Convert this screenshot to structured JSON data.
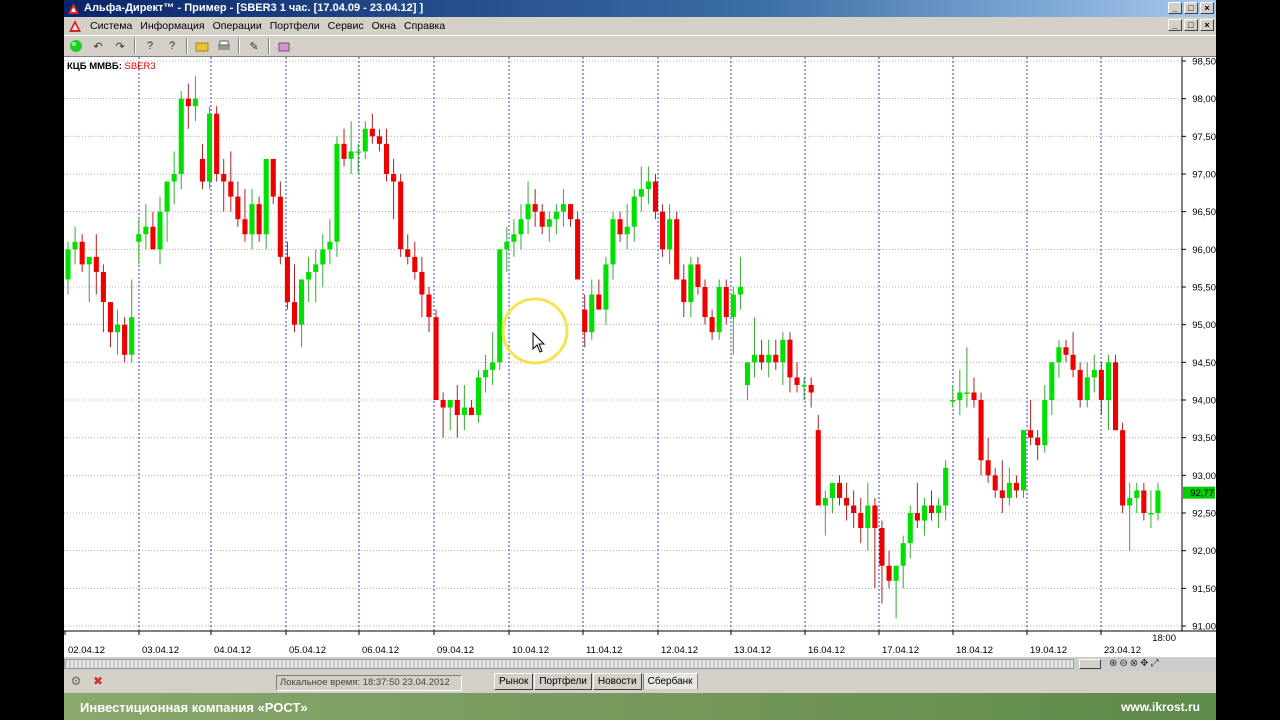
{
  "window": {
    "title": "Альфа-Директ™ - Пример - [SBER3  1 час. [17.04.09 - 23.04.12] ]",
    "controls": [
      "_",
      "□",
      "×"
    ],
    "mdi_controls": [
      "_",
      "□",
      "×"
    ]
  },
  "menu": {
    "items": [
      "Система",
      "Информация",
      "Операции",
      "Портфели",
      "Сервис",
      "Окна",
      "Справка"
    ]
  },
  "toolbar": {
    "icons": [
      "connect-icon",
      "undo-icon",
      "redo-icon",
      "help-icon",
      "help-pointer-icon",
      "folder-icon",
      "print-icon",
      "order-icon",
      "portfolio-icon"
    ]
  },
  "chart_header": {
    "exchange": "КЦБ ММВБ:",
    "symbol": "SBER3"
  },
  "chart_data": {
    "type": "candlestick",
    "ylim": [
      90.9,
      98.6
    ],
    "yticks": [
      "98,50",
      "98,00",
      "97,50",
      "97,00",
      "96,50",
      "96,00",
      "95,50",
      "95,00",
      "94,50",
      "94,00",
      "93,50",
      "93,00",
      "92,50",
      "92,00",
      "91,50",
      "91,00"
    ],
    "xticks": [
      "02.04.12",
      "03.04.12",
      "04.04.12",
      "05.04.12",
      "06.04.12",
      "09.04.12",
      "10.04.12",
      "11.04.12",
      "12.04.12",
      "13.04.12",
      "16.04.12",
      "17.04.12",
      "18.04.12",
      "19.04.12",
      "23.04.12"
    ],
    "last_tick_time": "18:00",
    "current_price_label": "92,77",
    "up_color": "#00e000",
    "down_color": "#ee0000",
    "candles": [
      [
        95.6,
        96.1,
        95.4,
        96.0
      ],
      [
        96.0,
        96.3,
        95.8,
        96.1
      ],
      [
        96.1,
        96.2,
        95.7,
        95.8
      ],
      [
        95.8,
        95.9,
        95.3,
        95.9
      ],
      [
        95.9,
        96.2,
        95.4,
        95.7
      ],
      [
        95.7,
        95.8,
        94.9,
        95.3
      ],
      [
        95.3,
        95.3,
        94.7,
        94.9
      ],
      [
        94.9,
        95.2,
        94.6,
        95.0
      ],
      [
        95.0,
        95.1,
        94.5,
        94.6
      ],
      [
        94.6,
        95.6,
        94.5,
        95.1
      ],
      [
        96.1,
        96.4,
        95.8,
        96.2
      ],
      [
        96.2,
        96.6,
        96.0,
        96.3
      ],
      [
        96.3,
        96.5,
        96.0,
        96.0
      ],
      [
        96.0,
        96.7,
        95.8,
        96.5
      ],
      [
        96.5,
        96.9,
        96.1,
        96.9
      ],
      [
        96.9,
        97.3,
        96.6,
        97.0
      ],
      [
        97.0,
        98.1,
        96.8,
        98.0
      ],
      [
        98.0,
        98.2,
        97.6,
        97.9
      ],
      [
        97.9,
        98.3,
        97.7,
        98.0
      ],
      [
        97.2,
        97.4,
        96.8,
        96.9
      ],
      [
        96.9,
        97.9,
        96.8,
        97.8
      ],
      [
        97.8,
        97.9,
        96.9,
        97.0
      ],
      [
        97.0,
        97.2,
        96.5,
        96.9
      ],
      [
        96.9,
        97.3,
        96.5,
        96.7
      ],
      [
        96.7,
        96.9,
        96.3,
        96.4
      ],
      [
        96.4,
        96.8,
        96.1,
        96.2
      ],
      [
        96.2,
        96.8,
        96.0,
        96.6
      ],
      [
        96.6,
        96.7,
        96.1,
        96.2
      ],
      [
        96.2,
        97.2,
        96.0,
        97.2
      ],
      [
        97.2,
        97.2,
        96.6,
        96.7
      ],
      [
        96.7,
        96.9,
        95.8,
        95.9
      ],
      [
        95.9,
        96.1,
        95.2,
        95.3
      ],
      [
        95.3,
        95.8,
        94.9,
        95.0
      ],
      [
        95.0,
        95.6,
        94.7,
        95.6
      ],
      [
        95.6,
        95.9,
        95.3,
        95.7
      ],
      [
        95.7,
        96.0,
        95.3,
        95.8
      ],
      [
        95.8,
        96.2,
        95.5,
        96.0
      ],
      [
        96.0,
        96.4,
        95.8,
        96.1
      ],
      [
        96.1,
        97.5,
        95.9,
        97.4
      ],
      [
        97.4,
        97.6,
        97.1,
        97.2
      ],
      [
        97.2,
        97.7,
        97.0,
        97.3
      ],
      [
        97.3,
        97.4,
        97.0,
        97.3
      ],
      [
        97.3,
        97.7,
        97.2,
        97.6
      ],
      [
        97.6,
        97.8,
        97.4,
        97.5
      ],
      [
        97.5,
        97.6,
        97.3,
        97.4
      ],
      [
        97.4,
        97.6,
        96.9,
        97.0
      ],
      [
        97.0,
        97.2,
        96.4,
        96.9
      ],
      [
        96.9,
        97.0,
        95.9,
        96.0
      ],
      [
        96.0,
        96.2,
        95.8,
        95.9
      ],
      [
        95.9,
        96.1,
        95.6,
        95.7
      ],
      [
        95.7,
        95.9,
        95.1,
        95.4
      ],
      [
        95.4,
        95.5,
        94.9,
        95.1
      ],
      [
        95.1,
        95.2,
        94.5,
        94.0
      ],
      [
        94.0,
        94.1,
        93.5,
        93.9
      ],
      [
        93.9,
        94.0,
        93.6,
        94.0
      ],
      [
        94.0,
        94.2,
        93.5,
        93.8
      ],
      [
        93.8,
        94.2,
        93.6,
        93.9
      ],
      [
        93.9,
        94.0,
        93.8,
        93.8
      ],
      [
        93.8,
        94.4,
        93.7,
        94.3
      ],
      [
        94.3,
        94.6,
        94.1,
        94.4
      ],
      [
        94.4,
        94.9,
        94.2,
        94.5
      ],
      [
        94.5,
        95.6,
        94.4,
        96.0
      ],
      [
        96.0,
        96.3,
        95.7,
        96.1
      ],
      [
        96.1,
        96.4,
        95.9,
        96.2
      ],
      [
        96.2,
        96.6,
        96.0,
        96.4
      ],
      [
        96.4,
        96.9,
        96.2,
        96.6
      ],
      [
        96.6,
        96.8,
        96.3,
        96.5
      ],
      [
        96.5,
        96.6,
        96.2,
        96.3
      ],
      [
        96.3,
        96.5,
        96.1,
        96.4
      ],
      [
        96.4,
        96.6,
        96.2,
        96.5
      ],
      [
        96.5,
        96.8,
        96.3,
        96.6
      ],
      [
        96.6,
        96.6,
        96.3,
        96.4
      ],
      [
        96.4,
        96.5,
        95.6,
        95.6
      ],
      [
        95.2,
        95.4,
        94.7,
        94.9
      ],
      [
        94.9,
        95.6,
        94.8,
        95.4
      ],
      [
        95.4,
        95.6,
        95.2,
        95.2
      ],
      [
        95.2,
        95.9,
        95.0,
        95.8
      ],
      [
        95.8,
        96.5,
        95.6,
        96.4
      ],
      [
        96.4,
        96.5,
        96.1,
        96.2
      ],
      [
        96.2,
        96.6,
        96.0,
        96.3
      ],
      [
        96.3,
        96.8,
        96.1,
        96.7
      ],
      [
        96.7,
        97.1,
        96.5,
        96.8
      ],
      [
        96.8,
        97.1,
        96.6,
        96.9
      ],
      [
        96.9,
        97.0,
        96.4,
        96.5
      ],
      [
        96.5,
        96.6,
        95.9,
        96.0
      ],
      [
        96.0,
        96.6,
        95.8,
        96.4
      ],
      [
        96.4,
        96.5,
        95.6,
        95.6
      ],
      [
        95.6,
        95.8,
        95.1,
        95.3
      ],
      [
        95.3,
        95.9,
        95.1,
        95.8
      ],
      [
        95.8,
        95.9,
        95.4,
        95.5
      ],
      [
        95.5,
        95.6,
        95.0,
        95.1
      ],
      [
        95.1,
        95.2,
        94.8,
        94.9
      ],
      [
        94.9,
        95.6,
        94.8,
        95.5
      ],
      [
        95.5,
        95.6,
        95.0,
        95.1
      ],
      [
        95.1,
        95.5,
        94.6,
        95.4
      ],
      [
        95.4,
        95.9,
        95.2,
        95.5
      ],
      [
        94.2,
        94.5,
        94.0,
        94.5
      ],
      [
        94.5,
        95.1,
        94.3,
        94.6
      ],
      [
        94.6,
        94.8,
        94.4,
        94.5
      ],
      [
        94.5,
        94.8,
        94.3,
        94.6
      ],
      [
        94.6,
        94.8,
        94.4,
        94.5
      ],
      [
        94.5,
        94.9,
        94.2,
        94.8
      ],
      [
        94.8,
        94.9,
        94.1,
        94.3
      ],
      [
        94.3,
        94.5,
        94.1,
        94.2
      ],
      [
        94.2,
        94.3,
        94.0,
        94.2
      ],
      [
        94.2,
        94.3,
        93.9,
        94.1
      ],
      [
        93.6,
        93.8,
        92.7,
        92.6
      ],
      [
        92.6,
        92.8,
        92.2,
        92.7
      ],
      [
        92.7,
        92.9,
        92.5,
        92.9
      ],
      [
        92.9,
        93.0,
        92.6,
        92.7
      ],
      [
        92.7,
        92.9,
        92.4,
        92.6
      ],
      [
        92.6,
        92.8,
        92.3,
        92.5
      ],
      [
        92.5,
        92.7,
        92.1,
        92.3
      ],
      [
        92.3,
        92.9,
        92.0,
        92.6
      ],
      [
        92.6,
        92.7,
        91.5,
        92.3
      ],
      [
        92.3,
        92.4,
        91.3,
        91.8
      ],
      [
        91.8,
        92.0,
        91.5,
        91.6
      ],
      [
        91.6,
        91.8,
        91.1,
        91.8
      ],
      [
        91.8,
        92.2,
        91.5,
        92.1
      ],
      [
        92.1,
        92.6,
        91.9,
        92.5
      ],
      [
        92.5,
        92.9,
        92.3,
        92.4
      ],
      [
        92.4,
        92.7,
        92.2,
        92.6
      ],
      [
        92.6,
        92.8,
        92.4,
        92.5
      ],
      [
        92.5,
        92.7,
        92.3,
        92.6
      ],
      [
        92.6,
        93.2,
        92.4,
        93.1
      ],
      [
        94.0,
        94.2,
        93.9,
        94.0
      ],
      [
        94.0,
        94.4,
        93.8,
        94.1
      ],
      [
        94.1,
        94.7,
        93.9,
        94.1
      ],
      [
        94.1,
        94.3,
        93.9,
        94.0
      ],
      [
        94.0,
        94.1,
        93.0,
        93.2
      ],
      [
        93.2,
        93.5,
        92.9,
        93.0
      ],
      [
        93.0,
        93.1,
        92.7,
        92.8
      ],
      [
        92.8,
        93.2,
        92.5,
        92.7
      ],
      [
        92.7,
        93.1,
        92.6,
        92.9
      ],
      [
        92.9,
        93.0,
        92.7,
        92.8
      ],
      [
        92.8,
        93.6,
        92.7,
        93.6
      ],
      [
        93.6,
        94.0,
        93.4,
        93.5
      ],
      [
        93.5,
        93.6,
        93.2,
        93.4
      ],
      [
        93.4,
        94.2,
        93.3,
        94.0
      ],
      [
        94.0,
        94.5,
        93.8,
        94.5
      ],
      [
        94.5,
        94.8,
        94.3,
        94.7
      ],
      [
        94.7,
        94.8,
        94.5,
        94.6
      ],
      [
        94.6,
        94.9,
        94.3,
        94.4
      ],
      [
        94.4,
        94.5,
        93.9,
        94.0
      ],
      [
        94.0,
        94.5,
        93.9,
        94.3
      ],
      [
        94.3,
        94.6,
        94.1,
        94.4
      ],
      [
        94.4,
        94.5,
        93.8,
        94.0
      ],
      [
        94.0,
        94.6,
        93.6,
        94.5
      ],
      [
        94.5,
        94.6,
        93.6,
        93.6
      ],
      [
        93.6,
        93.7,
        92.5,
        92.6
      ],
      [
        92.6,
        92.9,
        92.0,
        92.7
      ],
      [
        92.7,
        92.9,
        92.5,
        92.8
      ],
      [
        92.8,
        92.9,
        92.4,
        92.5
      ],
      [
        92.5,
        92.8,
        92.3,
        92.5
      ],
      [
        92.5,
        92.9,
        92.4,
        92.8
      ]
    ]
  },
  "statusbar": {
    "local_time": "Локальное время: 18:37:50 23.04.2012",
    "tabs": [
      "Рынок",
      "Портфели",
      "Новости",
      "Сбербанк"
    ],
    "active_tab": "Сбербанк"
  },
  "footer": {
    "company": "Инвестиционная компания «РОСТ»",
    "site": "www.ikrost.ru"
  }
}
